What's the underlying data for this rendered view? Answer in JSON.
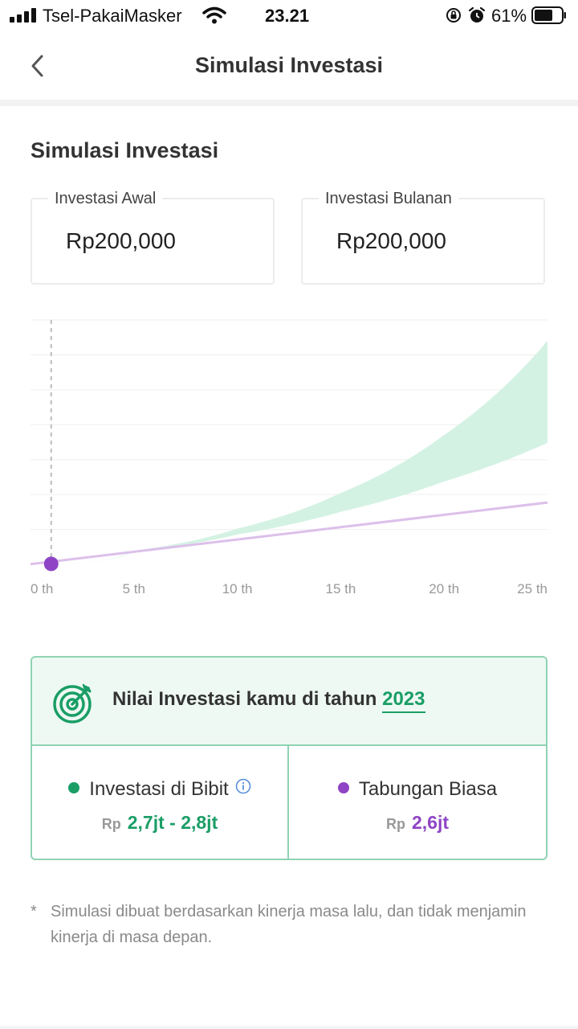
{
  "status_bar": {
    "carrier": "Tsel-PakaiMasker",
    "time": "23.21",
    "battery": "61%"
  },
  "nav": {
    "title": "Simulasi Investasi"
  },
  "section": {
    "title": "Simulasi Investasi"
  },
  "inputs": {
    "initial": {
      "label": "Investasi Awal",
      "value": "Rp200,000"
    },
    "monthly": {
      "label": "Investasi Bulanan",
      "value": "Rp200,000"
    }
  },
  "chart_data": {
    "type": "area",
    "x": [
      0,
      5,
      10,
      15,
      20,
      25
    ],
    "tick_labels": [
      "0 th",
      "5 th",
      "10 th",
      "15 th",
      "20 th",
      "25 th"
    ],
    "series": [
      {
        "name": "Investasi di Bibit (low)",
        "values": [
          0.2,
          12.6,
          29.3,
          51.6,
          81.3,
          119.3
        ]
      },
      {
        "name": "Investasi di Bibit (high)",
        "values": [
          0.2,
          13.5,
          35.1,
          70.1,
          127.0,
          219.6
        ]
      },
      {
        "name": "Tabungan Biasa",
        "values": [
          0.2,
          12.3,
          24.4,
          36.5,
          48.6,
          60.7
        ]
      }
    ],
    "marker_x": 1,
    "ylim": [
      0,
      240
    ],
    "grid": true,
    "colors": {
      "band": "#d4f2e4",
      "savings": "#dcc0ea",
      "marker": "#8e44c4",
      "grid": "#efefef",
      "guide": "#bdbdbd"
    }
  },
  "result": {
    "title_prefix": "Nilai Investasi kamu di tahun",
    "year": "2023",
    "bibit": {
      "label": "Investasi di Bibit",
      "currency": "Rp",
      "value": "2,7jt - 2,8jt",
      "color": "#1a9e66"
    },
    "savings": {
      "label": "Tabungan Biasa",
      "currency": "Rp",
      "value": "2,6jt",
      "color": "#8e44c4"
    }
  },
  "disclaimer": {
    "mark": "*",
    "text": "Simulasi dibuat berdasarkan kinerja masa lalu, dan tidak menjamin kinerja di masa depan."
  },
  "icons": {
    "back": "chevron-left-icon",
    "target": "target-icon",
    "info": "info-icon",
    "signal": "signal-icon",
    "wifi": "wifi-icon",
    "lock": "rotation-lock-icon",
    "alarm": "alarm-icon",
    "battery": "battery-icon"
  }
}
